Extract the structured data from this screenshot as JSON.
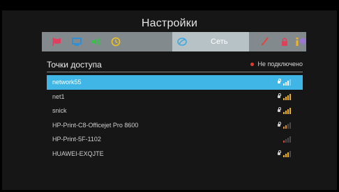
{
  "header": {
    "title": "Настройки"
  },
  "tabs": [
    {
      "icon": "flag-icon",
      "color": "#e04060"
    },
    {
      "icon": "monitor-icon",
      "color": "#2f8fd6"
    },
    {
      "icon": "speaker-icon",
      "color": "#38c24a"
    },
    {
      "icon": "clock-icon",
      "color": "#f2c21e"
    },
    {
      "icon": "network-icon",
      "color": "#3fa8e0",
      "label": "Сеть",
      "active": true
    },
    {
      "icon": "brush-icon",
      "color": "#e8433a"
    },
    {
      "icon": "lock-icon",
      "color": "#e0405a"
    },
    {
      "icon": "balloon-icon",
      "color": "#9a78cf"
    },
    {
      "icon": "info-icon",
      "color": "#f2b51c"
    }
  ],
  "access_points": {
    "title": "Точки доступа",
    "status_text": "Не подключено",
    "status_color": "#e23b2e",
    "networks": [
      {
        "name": "network55",
        "secured": true,
        "signal": 3,
        "selected": true
      },
      {
        "name": "net1",
        "secured": true,
        "signal": 4,
        "selected": false
      },
      {
        "name": "snick",
        "secured": true,
        "signal": 4,
        "selected": false
      },
      {
        "name": "HP-Print-C8-Officejet Pro 8600",
        "secured": true,
        "signal": 2,
        "selected": false
      },
      {
        "name": "HP-Print-5F-1102",
        "secured": false,
        "signal": 1,
        "selected": false
      },
      {
        "name": "HUAWEI-EXQJTE",
        "secured": true,
        "signal": 3,
        "selected": false
      }
    ]
  }
}
